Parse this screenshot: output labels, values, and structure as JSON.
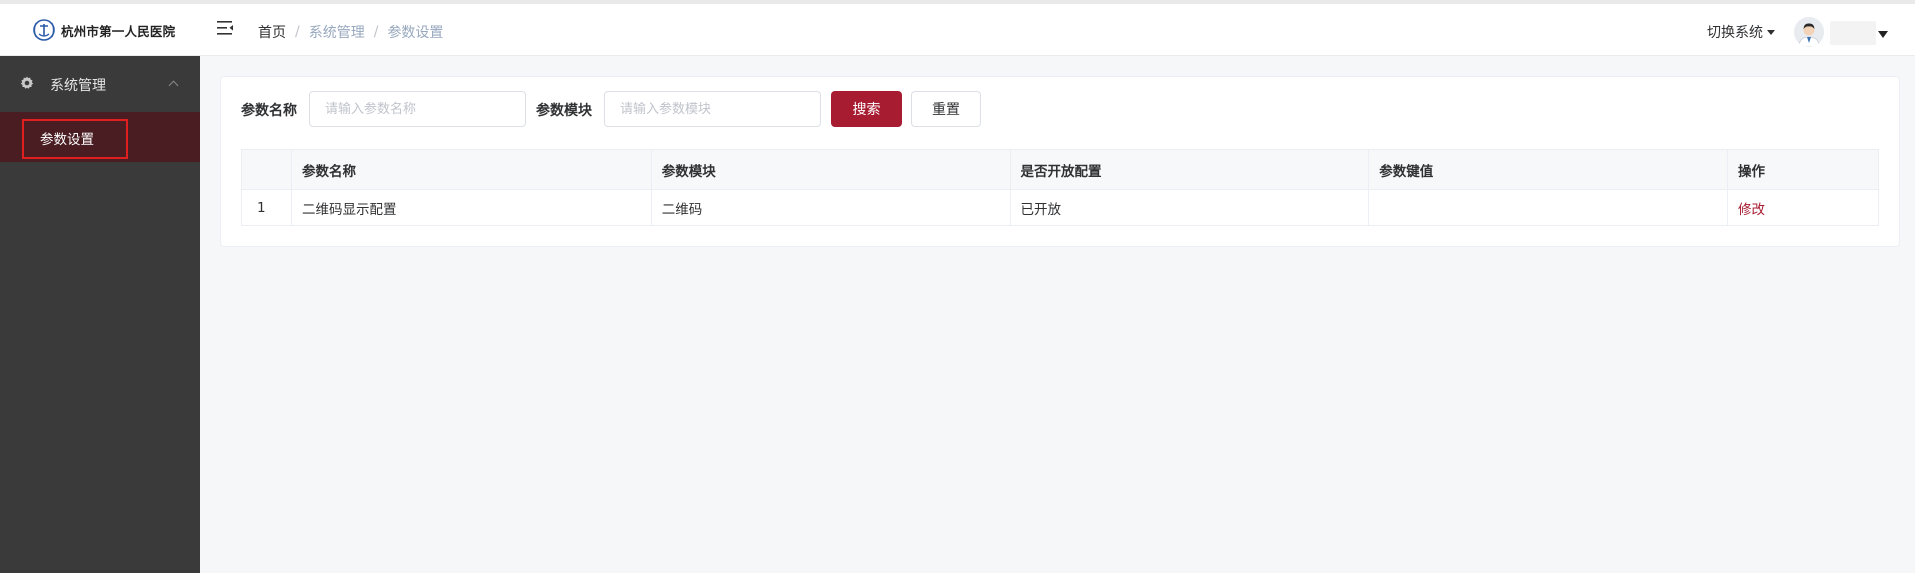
{
  "header": {
    "logo_text": "杭州市第一人民医院",
    "breadcrumb": [
      "首页",
      "系统管理",
      "参数设置"
    ],
    "switch_system_label": "切换系统"
  },
  "sidebar": {
    "group_label": "系统管理",
    "group_icon": "gear-icon",
    "items": [
      {
        "label": "参数设置",
        "active": true
      }
    ]
  },
  "search": {
    "name_label": "参数名称",
    "name_placeholder": "请输入参数名称",
    "module_label": "参数模块",
    "module_placeholder": "请输入参数模块",
    "search_button": "搜索",
    "reset_button": "重置"
  },
  "table": {
    "columns": [
      "",
      "参数名称",
      "参数模块",
      "是否开放配置",
      "参数键值",
      "操作"
    ],
    "rows": [
      {
        "index": "1",
        "name": "二维码显示配置",
        "module": "二维码",
        "open": "已开放",
        "key_value": "",
        "action": "修改"
      }
    ]
  },
  "colors": {
    "primary": "#a81c32",
    "sidebar_bg": "#3a3a3a",
    "sidebar_active_bg": "#4a1d23",
    "highlight_border": "#e02020"
  }
}
